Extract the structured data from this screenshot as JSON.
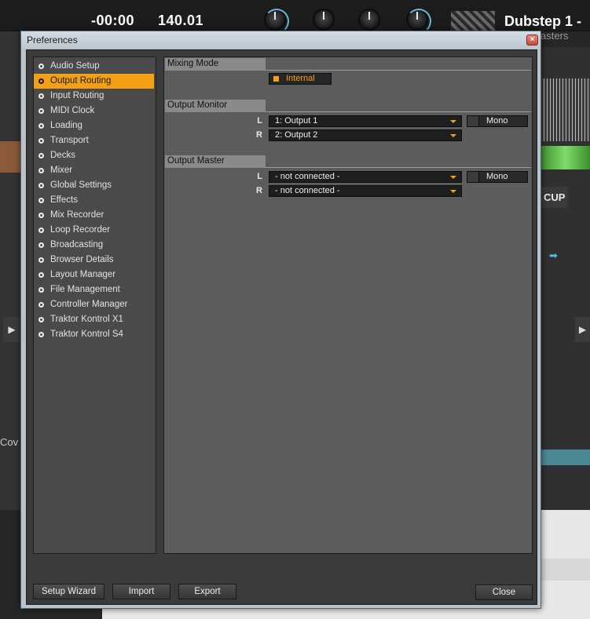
{
  "background_app": {
    "time_remaining": "-00:00",
    "bpm": "140.01",
    "track_title": "Dubstep 1 -",
    "track_subtitle": "asters",
    "cup_label": "CUP",
    "cover_label": "Cov"
  },
  "window": {
    "title": "Preferences",
    "close_glyph": "×"
  },
  "sidebar": {
    "items": [
      {
        "label": "Audio Setup",
        "selected": false
      },
      {
        "label": "Output Routing",
        "selected": true
      },
      {
        "label": "Input Routing",
        "selected": false
      },
      {
        "label": "MIDI Clock",
        "selected": false
      },
      {
        "label": "Loading",
        "selected": false
      },
      {
        "label": "Transport",
        "selected": false
      },
      {
        "label": "Decks",
        "selected": false
      },
      {
        "label": "Mixer",
        "selected": false
      },
      {
        "label": "Global Settings",
        "selected": false
      },
      {
        "label": "Effects",
        "selected": false
      },
      {
        "label": "Mix Recorder",
        "selected": false
      },
      {
        "label": "Loop Recorder",
        "selected": false
      },
      {
        "label": "Broadcasting",
        "selected": false
      },
      {
        "label": "Browser Details",
        "selected": false
      },
      {
        "label": "Layout Manager",
        "selected": false
      },
      {
        "label": "File Management",
        "selected": false
      },
      {
        "label": "Controller Manager",
        "selected": false
      },
      {
        "label": "Traktor Kontrol X1",
        "selected": false
      },
      {
        "label": "Traktor Kontrol S4",
        "selected": false
      }
    ]
  },
  "mixing_mode": {
    "heading": "Mixing Mode",
    "option": "Internal"
  },
  "output_monitor": {
    "heading": "Output Monitor",
    "left_label": "L",
    "right_label": "R",
    "left_value": "1: Output 1",
    "right_value": "2: Output 2",
    "mono_label": "Mono"
  },
  "output_master": {
    "heading": "Output Master",
    "left_label": "L",
    "right_label": "R",
    "left_value": "- not connected -",
    "right_value": "- not connected -",
    "mono_label": "Mono"
  },
  "footer": {
    "setup_wizard": "Setup Wizard",
    "import": "Import",
    "export": "Export",
    "close": "Close"
  },
  "colors": {
    "accent": "#f4a016",
    "panel": "#5c5c5c",
    "sidebar": "#4a4a4a"
  }
}
